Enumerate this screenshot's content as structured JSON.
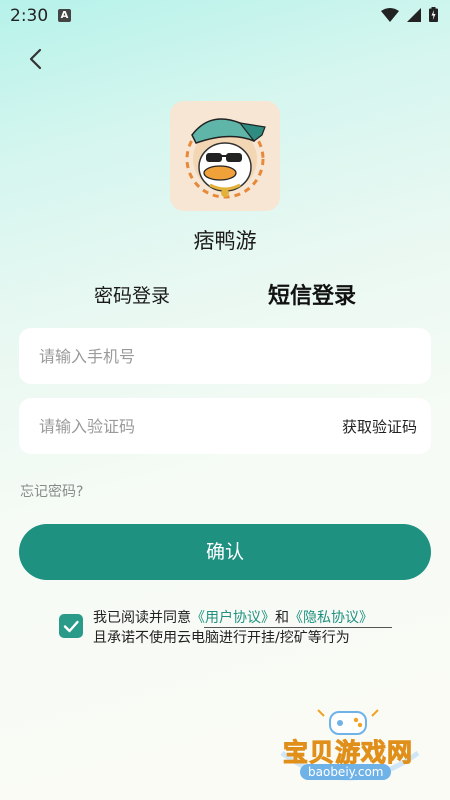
{
  "status_bar": {
    "time": "2:30",
    "notification_letter": "A"
  },
  "app": {
    "name": "痞鸭游"
  },
  "tabs": {
    "password_login": "密码登录",
    "sms_login": "短信登录"
  },
  "phone_field": {
    "placeholder": "请输入手机号",
    "value": ""
  },
  "code_field": {
    "placeholder": "请输入验证码",
    "value": ""
  },
  "get_code_label": "获取验证码",
  "forgot_password": "忘记密码?",
  "confirm_label": "确认",
  "agreement": {
    "checked": true,
    "prefix": "我已阅读并同意",
    "user_agreement": "《用户协议》",
    "and": "和",
    "privacy_policy": "《隐私协议》",
    "line2": "且承诺不使用云电脑进行开挂/挖矿等行为"
  },
  "watermark": {
    "title": "宝贝游戏网",
    "domain": "baobeiy.com"
  },
  "colors": {
    "accent": "#1f9181",
    "checkbox": "#2a9b89",
    "watermark": "#f2a321"
  }
}
